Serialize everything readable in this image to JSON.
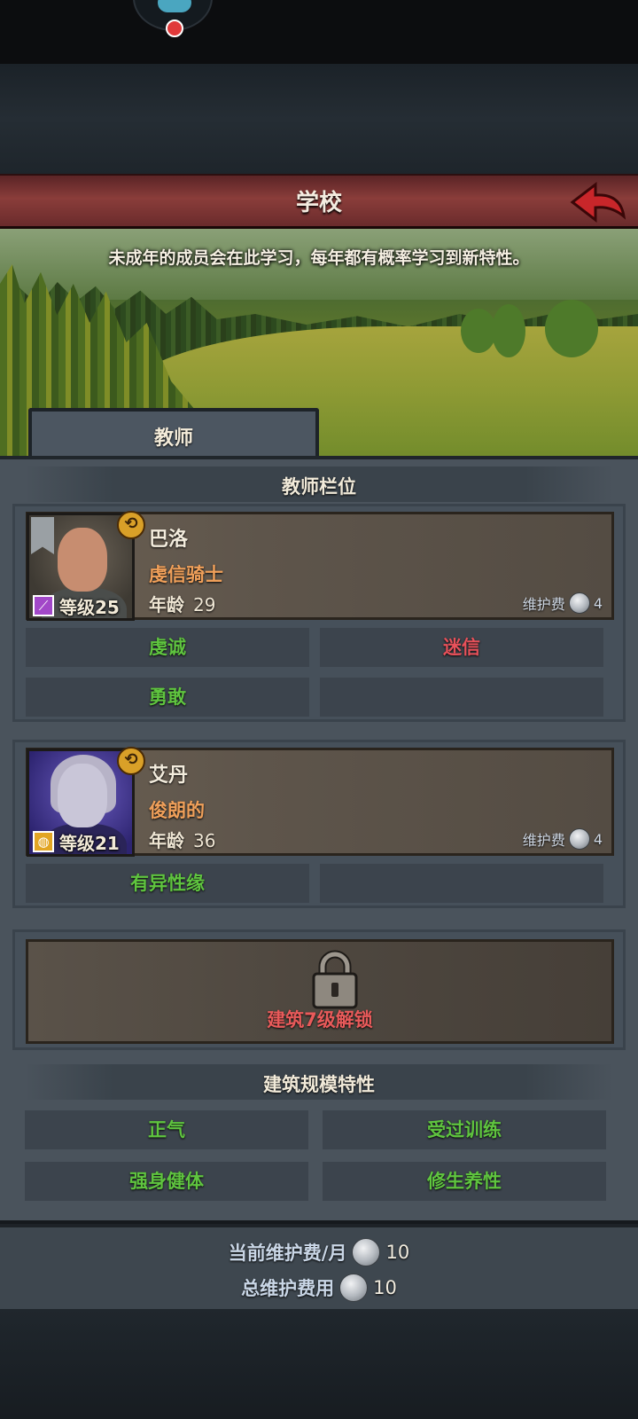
{
  "page": {
    "title": "学校",
    "description": "未成年的成员会在此学习，每年都有概率学习到新特性。"
  },
  "tabs": [
    {
      "label": "教师"
    }
  ],
  "teacher_slots": {
    "header": "教师栏位",
    "teachers": [
      {
        "name": "巴洛",
        "job": "虔信骑士",
        "level_label": "等级",
        "level": "25",
        "age_label": "年龄",
        "age": "29",
        "upkeep_label": "维护费",
        "upkeep": "4",
        "class_icon": "staff-icon",
        "traits": [
          {
            "label": "虔诚",
            "type": "good"
          },
          {
            "label": "迷信",
            "type": "bad"
          },
          {
            "label": "勇敢",
            "type": "good"
          },
          {
            "label": "",
            "type": "empty"
          }
        ]
      },
      {
        "name": "艾丹",
        "job": "俊朗的",
        "level_label": "等级",
        "level": "21",
        "age_label": "年龄",
        "age": "36",
        "upkeep_label": "维护费",
        "upkeep": "4",
        "class_icon": "shield-icon",
        "traits": [
          {
            "label": "有异性缘",
            "type": "good"
          },
          {
            "label": "",
            "type": "empty"
          }
        ]
      }
    ],
    "locked_slot": {
      "text": "建筑7级解锁"
    }
  },
  "building_traits": {
    "header": "建筑规模特性",
    "items": [
      "正气",
      "受过训练",
      "强身健体",
      "修生养性"
    ]
  },
  "footer": {
    "monthly_label": "当前维护费/月",
    "monthly_value": "10",
    "total_label": "总维护费用",
    "total_value": "10"
  },
  "colors": {
    "good_trait": "#5fc43f",
    "bad_trait": "#e7515a",
    "job": "#f0a05a",
    "title_bar": "#8a3d3a"
  }
}
